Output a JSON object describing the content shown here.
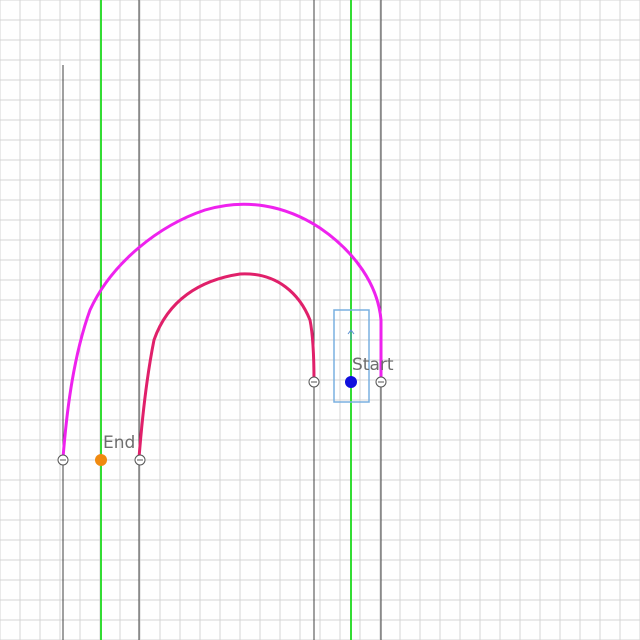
{
  "scene": {
    "colors": {
      "background": "#ffffff",
      "grid": "#d4d4d4",
      "lane_line": "#404040",
      "guide_line": "#33dd33",
      "outer_path": "#ee22ee",
      "inner_path": "#e0206a",
      "start_marker": "#1010dd",
      "end_marker": "#f08a10",
      "vehicle_box": "#7ab0e0",
      "node": "#555555"
    },
    "labels": {
      "start": "Start",
      "end": "End"
    },
    "icons": {
      "heading": "arrow-up-icon"
    }
  }
}
